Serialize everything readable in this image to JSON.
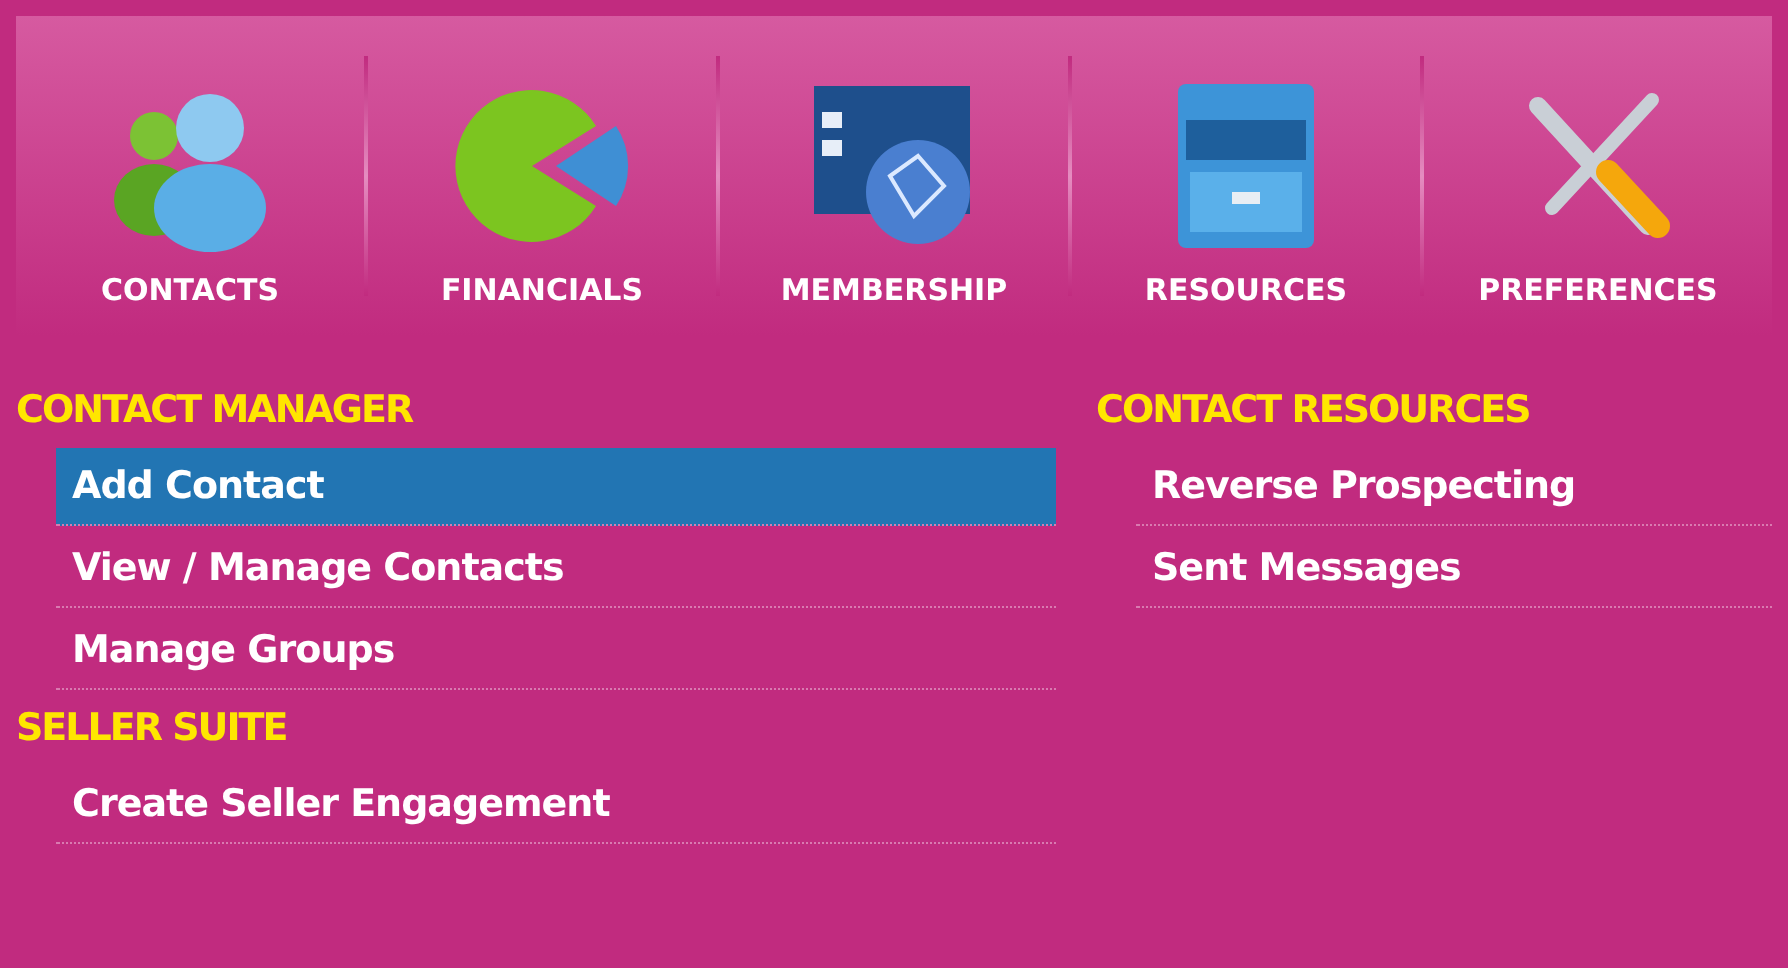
{
  "nav": [
    {
      "label": "CONTACTS",
      "kind": "contacts"
    },
    {
      "label": "FINANCIALS",
      "kind": "financials"
    },
    {
      "label": "MEMBERSHIP",
      "kind": "membership"
    },
    {
      "label": "RESOURCES",
      "kind": "resources"
    },
    {
      "label": "PREFERENCES",
      "kind": "preferences"
    }
  ],
  "columns": [
    {
      "sections": [
        {
          "title": "CONTACT MANAGER",
          "items": [
            {
              "label": "Add Contact",
              "selected": true
            },
            {
              "label": "View / Manage Contacts",
              "selected": false
            },
            {
              "label": "Manage Groups",
              "selected": false
            }
          ]
        },
        {
          "title": "SELLER SUITE",
          "items": [
            {
              "label": "Create Seller Engagement",
              "selected": false
            }
          ]
        }
      ]
    },
    {
      "sections": [
        {
          "title": "CONTACT RESOURCES",
          "items": [
            {
              "label": "Reverse Prospecting",
              "selected": false
            },
            {
              "label": "Sent Messages",
              "selected": false
            }
          ]
        }
      ]
    }
  ]
}
